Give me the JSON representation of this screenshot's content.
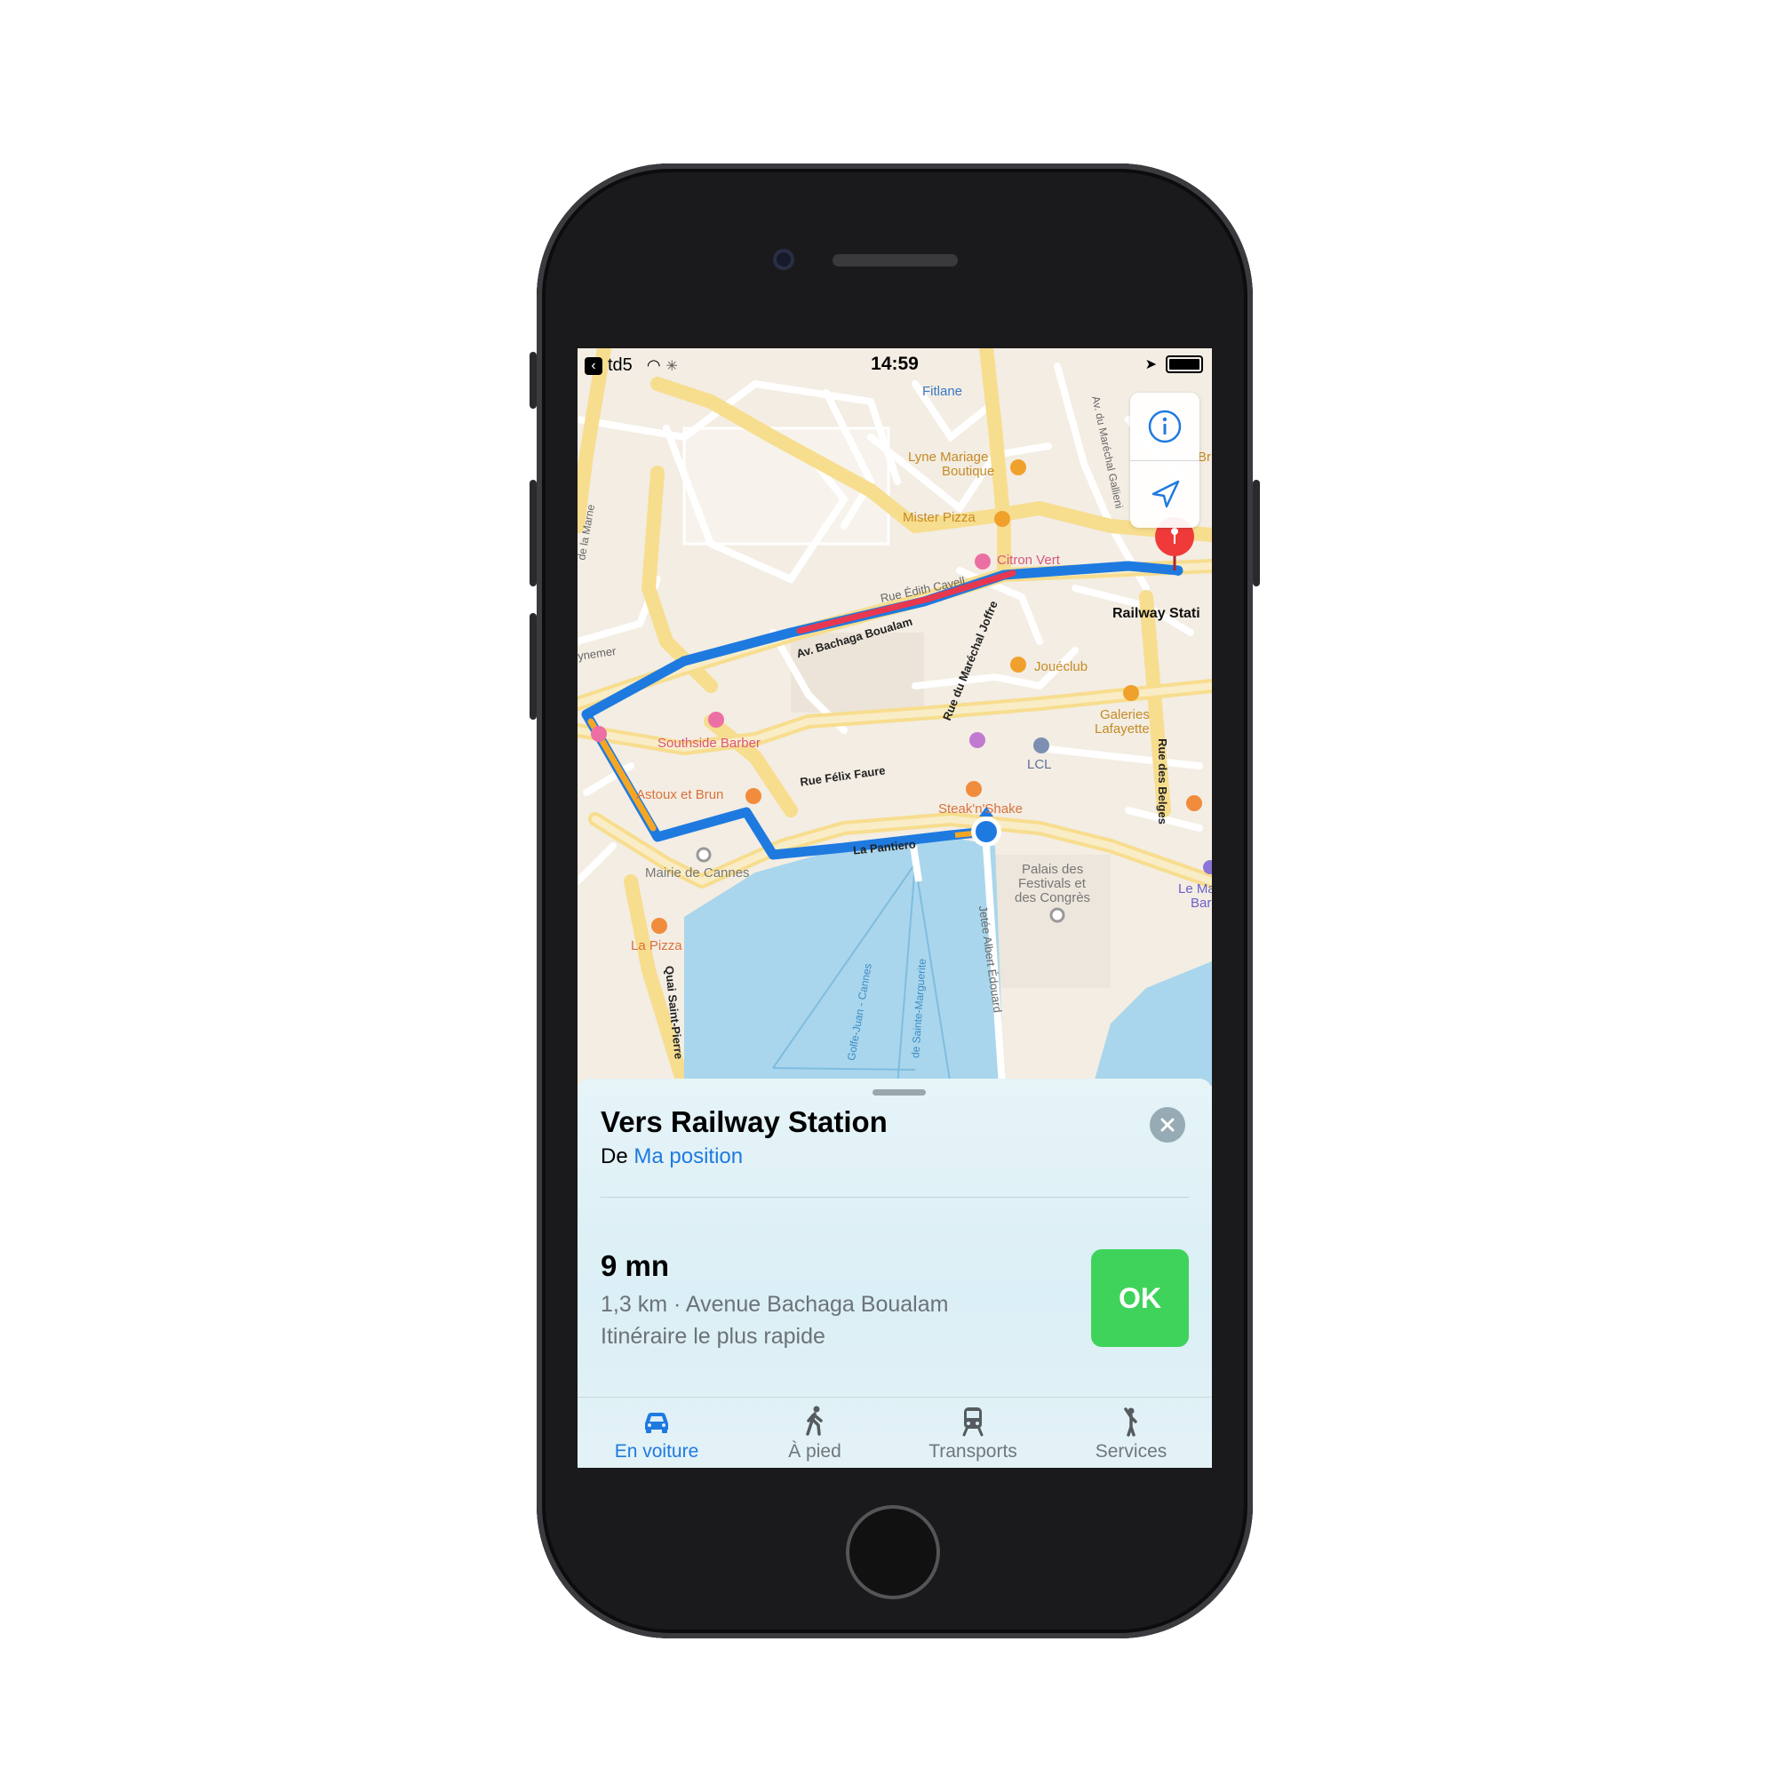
{
  "status_bar": {
    "back_app": "td5",
    "time": "14:59"
  },
  "map": {
    "labels": {
      "fitlane": "Fitlane",
      "lyne_1": "Lyne Mariage",
      "lyne_2": "Boutique",
      "mister_pizza": "Mister Pizza",
      "citron_vert": "Citron Vert",
      "rue_edith": "Rue Édith Cavell",
      "railway": "Railway Stati",
      "bachaga": "Av. Bachaga Boualam",
      "joffre": "Rue du Maréchal Joffre",
      "joueclub": "Jouéclub",
      "galeries_1": "Galeries",
      "galeries_2": "Lafayette",
      "southside": "Southside Barber",
      "lcl": "LCL",
      "astoux": "Astoux et Brun",
      "felix_faure": "Rue Félix Faure",
      "steak": "Steak'n'Shake",
      "pantiero": "La Pantiero",
      "mairie": "Mairie de Cannes",
      "palais_1": "Palais des",
      "palais_2": "Festivals et",
      "palais_3": "des Congrès",
      "belges": "Rue des Belges",
      "le_ma_1": "Le Ma",
      "le_ma_2": "Bar",
      "la_pizza": "La Pizza",
      "quai": "Quai Saint-Pierre",
      "jetee": "Jetée Albert Édouard",
      "golfe": "Golfe-Juan - Cannes",
      "sainte": "de Sainte-Marguerite",
      "marne": "de la Marne",
      "gallieni": "Av. du Maréchal Gallieni",
      "ynemer": "ynemer",
      "br": "Br"
    },
    "colors": {
      "route": "#1f7ae0",
      "traffic_heavy": "#e8384f",
      "traffic_moderate": "#f5a623",
      "pin": "#f03a3a",
      "water": "#a9d6ec"
    }
  },
  "sheet": {
    "title": "Vers Railway Station",
    "from_prefix": "De",
    "from_link": "Ma position",
    "eta": "9 mn",
    "detail": "1,3 km · Avenue Bachaga Boualam",
    "route_type": "Itinéraire le plus rapide",
    "ok_label": "OK"
  },
  "tabs": [
    {
      "label": "En voiture",
      "icon": "car-icon",
      "active": true
    },
    {
      "label": "À pied",
      "icon": "walking-icon",
      "active": false
    },
    {
      "label": "Transports",
      "icon": "train-icon",
      "active": false
    },
    {
      "label": "Services",
      "icon": "rideshare-icon",
      "active": false
    }
  ]
}
